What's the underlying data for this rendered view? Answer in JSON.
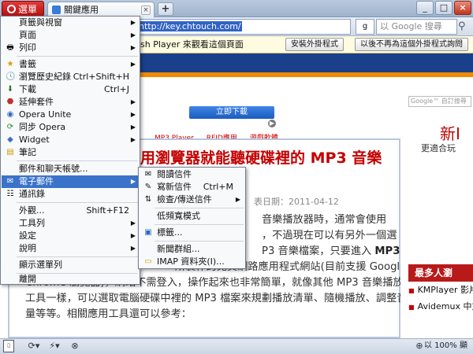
{
  "tabbar": {
    "menu_label": "選單",
    "tab_title": "關鍵應用",
    "tab_close": "×",
    "new_tab": "+",
    "minimize": "_",
    "maximize": "□",
    "close": "×"
  },
  "addressbar": {
    "url_prefix": "",
    "url_selected": "http://key.chtouch.com/",
    "search_engine_icon": "g",
    "search_placeholder": "以 Google 搜尋"
  },
  "pluginbar": {
    "message": "sh Player 來觀看這個頁面",
    "install_label": "安裝外掛程式",
    "never_ask_label": "以後不再為這個外掛程式詢問"
  },
  "page": {
    "ad_download": "立即下載",
    "ad_info": "▶",
    "nav_links": [
      "MP3 Player",
      "RFID應用",
      "遊戲軟體"
    ],
    "article_title": "用瀏覽器就能聽硬碟裡的 MP3 音樂",
    "article_date": "表日期：2011-04-12",
    "body": {
      "l1": "音樂播放器時，通常會使用",
      "l2": "，不過現在可以有另外一個選",
      "l3a": "P3 音樂檔案，只要進入 ",
      "l3b": "MP3",
      "l4": "所製作的免費網路應用程式網站(目前支援 Google",
      "l5": "Chrome 瀏覽器)，網站不需登入，操作起來也非常簡單，就像其他 MP3 音樂播放",
      "l6": "工具一樣，可以選取電腦硬碟中裡的 MP3 檔案來規劃播放清單、隨機播放、調整音",
      "l7": "量等等。相關應用工具還可以參考："
    },
    "google_search_label": "Google™ 自訂搜尋",
    "promo_heading": "新I",
    "promo_sub": "更適合玩",
    "popular_header": "最多人瀏",
    "popular_items": [
      "KMPlayer 影片版)",
      "Avidemux 中文版)"
    ]
  },
  "main_menu": {
    "items": [
      {
        "label": "頁籤與視窗",
        "icon": "",
        "shortcut": "",
        "arrow": "▶"
      },
      {
        "label": "頁面",
        "icon": "",
        "shortcut": "",
        "arrow": "▶"
      },
      {
        "label": "列印",
        "icon": "🖶",
        "shortcut": "",
        "arrow": "▶"
      },
      {
        "label": "書籤",
        "icon": "★",
        "shortcut": "",
        "arrow": "▶"
      },
      {
        "label": "瀏覽歷史紀錄",
        "icon": "🕓",
        "shortcut": "Ctrl+Shift+H",
        "arrow": ""
      },
      {
        "label": "下載",
        "icon": "⬇",
        "shortcut": "Ctrl+J",
        "arrow": ""
      },
      {
        "label": "延伸套件",
        "icon": "⬣",
        "shortcut": "",
        "arrow": "▶"
      },
      {
        "label": "Opera Unite",
        "icon": "◉",
        "shortcut": "",
        "arrow": "▶"
      },
      {
        "label": "同步 Opera",
        "icon": "⟳",
        "shortcut": "",
        "arrow": "▶"
      },
      {
        "label": "Widget",
        "icon": "◆",
        "shortcut": "",
        "arrow": "▶"
      },
      {
        "label": "筆記",
        "icon": "▤",
        "shortcut": "",
        "arrow": ""
      },
      {
        "label": "郵件和聊天帳號...",
        "icon": "",
        "shortcut": "",
        "arrow": ""
      },
      {
        "label": "電子郵件",
        "icon": "✉",
        "shortcut": "",
        "arrow": "▶"
      },
      {
        "label": "通訊錄",
        "icon": "☷",
        "shortcut": "",
        "arrow": ""
      },
      {
        "label": "外觀...",
        "icon": "",
        "shortcut": "Shift+F12",
        "arrow": ""
      },
      {
        "label": "工具列",
        "icon": "",
        "shortcut": "",
        "arrow": "▶"
      },
      {
        "label": "設定",
        "icon": "",
        "shortcut": "",
        "arrow": "▶"
      },
      {
        "label": "說明",
        "icon": "",
        "shortcut": "",
        "arrow": "▶"
      },
      {
        "label": "顯示選單列",
        "icon": "",
        "shortcut": "",
        "arrow": ""
      },
      {
        "label": "離開",
        "icon": "",
        "shortcut": "",
        "arrow": ""
      }
    ]
  },
  "mail_submenu": {
    "items": [
      {
        "label": "閱讀信件",
        "icon": "✉",
        "shortcut": "",
        "arrow": ""
      },
      {
        "label": "寫新信件",
        "icon": "✎",
        "shortcut": "Ctrl+M",
        "arrow": ""
      },
      {
        "label": "檢查/傳送信件",
        "icon": "⇅",
        "shortcut": "",
        "arrow": "▶"
      },
      {
        "label": "低頻寬模式",
        "icon": "",
        "shortcut": "",
        "arrow": ""
      },
      {
        "label": "標籤...",
        "icon": "▣",
        "shortcut": "",
        "arrow": ""
      },
      {
        "label": "新聞群組...",
        "icon": "",
        "shortcut": "",
        "arrow": ""
      },
      {
        "label": "IMAP 資料夾(I)...",
        "icon": "▭",
        "shortcut": "",
        "arrow": ""
      }
    ]
  },
  "statusbar": {
    "panel_toggle": "▯",
    "sync": "⟳▾",
    "unite": "⚡▾",
    "turbo": "⊗",
    "zoom_icon": "⊕",
    "zoom": "以 100% 顯示"
  },
  "colors": {
    "menu_button": "#c91e1e",
    "highlight": "#3a73c9",
    "article_title": "#c40000"
  }
}
